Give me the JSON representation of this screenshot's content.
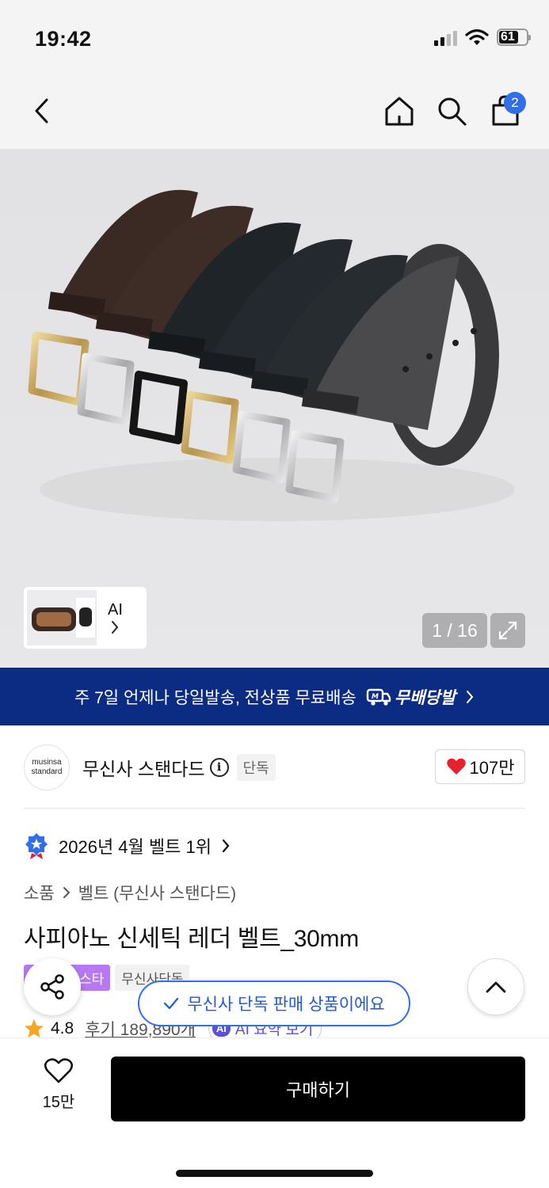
{
  "status": {
    "time": "19:42",
    "battery": "61"
  },
  "nav": {
    "cart_count": "2"
  },
  "gallery": {
    "counter": "1 / 16",
    "thumb_label": "AI"
  },
  "promo": {
    "text": "주 7일 언제나 당일발송, 전상품 무료배송",
    "logo_text": "무배당발"
  },
  "brand": {
    "logo_line1": "musinsa",
    "logo_line2": "standard",
    "name": "무신사 스탠다드",
    "info_glyph": "i",
    "exclusive": "단독",
    "likes": "107만"
  },
  "ranking": {
    "text": "2026년 4월 벨트 1위"
  },
  "breadcrumb": {
    "category": "소품",
    "subcategory": "벨트 (무신사 스탠다드)"
  },
  "product": {
    "title": "사피아노 신세틱 레더 벨트_30mm"
  },
  "tags": [
    {
      "label": "스타"
    },
    {
      "label": "무신사단독"
    }
  ],
  "rating": {
    "score": "4.8",
    "reviews": "후기 189,890개",
    "ai_badge": "AI",
    "ai_summary": "AI 요약 보기"
  },
  "toast": {
    "text": "무신사 단독 판매 상품이에요"
  },
  "bottom": {
    "wish_count": "15만",
    "buy_label": "구매하기"
  },
  "colors": {
    "accent_blue": "#2f6fe8",
    "banner_navy": "#0c2c84",
    "heart_red": "#e8202d",
    "tag_purple": "#b679ef"
  },
  "icons": [
    "back-icon",
    "home-icon",
    "search-icon",
    "cart-icon",
    "chevron-right-icon",
    "expand-icon",
    "truck-icon",
    "info-icon",
    "heart-icon",
    "rank-badge-icon",
    "star-icon",
    "share-icon",
    "chevron-up-icon",
    "check-icon"
  ]
}
